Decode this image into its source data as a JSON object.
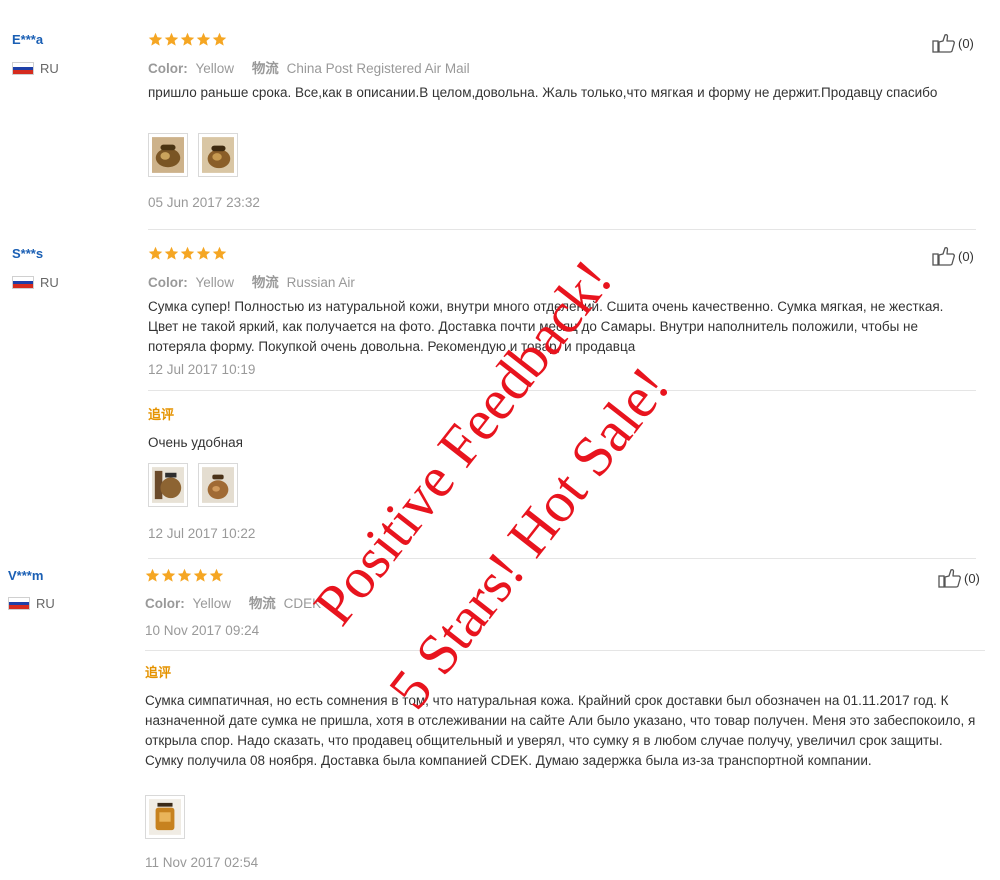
{
  "reviews": [
    {
      "user": "E***a",
      "country": "RU",
      "color_label": "Color:",
      "color_value": "Yellow",
      "logistics_label": "物流",
      "logistics_value": "China Post Registered Air Mail",
      "rating": 5,
      "text": "пришло раньше срока. Все,как в описании.В целом,довольна. Жаль только,что мягкая и форму не держит.Продавцу спасибо",
      "photo_count": 2,
      "date": "05 Jun 2017 23:32",
      "likes": "(0)"
    },
    {
      "user": "S***s",
      "country": "RU",
      "color_label": "Color:",
      "color_value": "Yellow",
      "logistics_label": "物流",
      "logistics_value": "Russian Air",
      "rating": 5,
      "text": "Сумка супер! Полностью из натуральной кожи, внутри много отделений. Сшита очень качественно. Сумка мягкая, не жесткая. Цвет не такой яркий, как получается на фото. Доставка почти месяц до Самары. Внутри наполнитель положили, чтобы не потеряла форму. Покупкой очень довольна. Рекомендую и товар, и продавца",
      "date": "12 Jul 2017 10:19",
      "followup_label": "追评",
      "followup_text": "Очень удобная",
      "followup_photo_count": 2,
      "followup_date": "12 Jul 2017 10:22",
      "likes": "(0)"
    },
    {
      "user": "V***m",
      "country": "RU",
      "color_label": "Color:",
      "color_value": "Yellow",
      "logistics_label": "物流",
      "logistics_value": "CDEK",
      "rating": 5,
      "date": "10 Nov 2017 09:24",
      "followup_label": "追评",
      "followup_text": "Сумка симпатичная, но есть сомнения в том, что натуральная кожа. Крайний срок доставки был обозначен на 01.11.2017 год. К назначенной дате сумка не пришла, хотя в отслеживании на сайте Али было указано, что товар получен. Меня это забеспокоило, я открыла спор. Надо сказать, что продавец общительный и уверял, что сумку я в любом случае получу, увеличил срок защиты. Сумку получила 08 ноября. Доставка была компанией CDEK. Думаю задержка была из-за транспортной компании.",
      "followup_photo_count": 1,
      "followup_date": "11 Nov 2017 02:54",
      "likes": "(0)"
    }
  ],
  "overlay": {
    "line1": "Positive Feedback!",
    "line2": "5 Stars! Hot Sale!",
    "color": "#e8141e"
  },
  "colors": {
    "username": "#1a5fb4",
    "star": "#f5a623",
    "followup_label": "#e59300",
    "muted": "#999999"
  },
  "icons": {
    "like": "thumbs-up-icon",
    "flag": "russia-flag-icon",
    "star": "star-icon"
  }
}
